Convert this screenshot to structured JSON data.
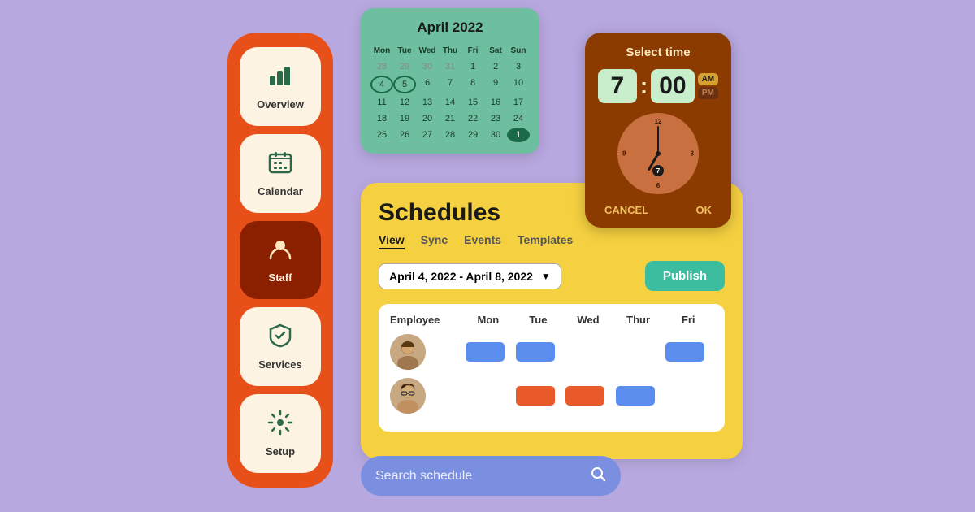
{
  "background": "#b8a8e0",
  "sidebar": {
    "items": [
      {
        "label": "Overview",
        "icon": "📊",
        "active": false
      },
      {
        "label": "Calendar",
        "icon": "📅",
        "active": false
      },
      {
        "label": "Staff",
        "icon": "👤",
        "active": true
      },
      {
        "label": "Services",
        "icon": "🛡️",
        "active": false
      },
      {
        "label": "Setup",
        "icon": "⚙️",
        "active": false
      }
    ]
  },
  "calendar": {
    "title": "April 2022",
    "weekdays": [
      "Mon",
      "Tue",
      "Wed",
      "Thu",
      "Fri",
      "Sat",
      "Sun"
    ],
    "rows": [
      [
        "28",
        "29",
        "30",
        "31",
        "1",
        "2",
        "3"
      ],
      [
        "4",
        "5",
        "6",
        "7",
        "8",
        "9",
        "10"
      ],
      [
        "11",
        "12",
        "13",
        "14",
        "15",
        "16",
        "17"
      ],
      [
        "18",
        "19",
        "20",
        "21",
        "22",
        "23",
        "24"
      ],
      [
        "25",
        "26",
        "27",
        "28",
        "29",
        "30",
        "1"
      ]
    ],
    "selected_days": [
      "4",
      "5"
    ],
    "today": "1"
  },
  "time_picker": {
    "title": "Select time",
    "hour": "7",
    "minute": "00",
    "am": "AM",
    "pm": "PM",
    "active_period": "AM",
    "cancel_label": "CANCEL",
    "ok_label": "OK"
  },
  "schedules": {
    "title": "Schedules",
    "tabs": [
      "View",
      "Sync",
      "Events",
      "Templates"
    ],
    "active_tab": "View",
    "date_range": "April 4, 2022 - April 8, 2022",
    "publish_label": "Publish",
    "table": {
      "headers": [
        "Employee",
        "Mon",
        "Tue",
        "Wed",
        "Thur",
        "Fri"
      ],
      "rows": [
        {
          "avatar": "👨",
          "shifts": [
            {
              "day": "Mon",
              "type": "blue"
            },
            {
              "day": "Tue",
              "type": "blue"
            },
            {
              "day": "Wed",
              "type": "none"
            },
            {
              "day": "Thur",
              "type": "none"
            },
            {
              "day": "Fri",
              "type": "blue"
            }
          ]
        },
        {
          "avatar": "👩",
          "shifts": [
            {
              "day": "Mon",
              "type": "none"
            },
            {
              "day": "Tue",
              "type": "orange"
            },
            {
              "day": "Wed",
              "type": "orange"
            },
            {
              "day": "Thur",
              "type": "blue"
            },
            {
              "day": "Fri",
              "type": "none"
            }
          ]
        }
      ]
    }
  },
  "search": {
    "placeholder": "Search schedule",
    "value": ""
  }
}
